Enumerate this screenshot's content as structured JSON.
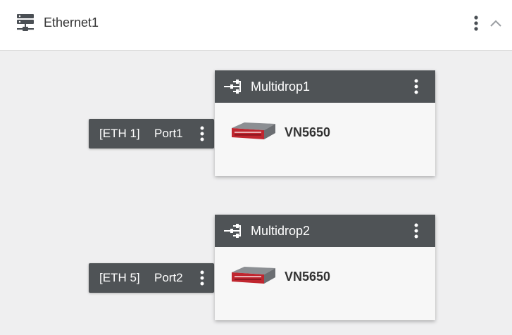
{
  "header": {
    "title": "Ethernet1",
    "network_icon": "server-network-icon",
    "menu_icon": "more-vertical-icon",
    "collapse_icon": "chevron-up-icon"
  },
  "ports": [
    {
      "tag": "[ETH 1]",
      "name": "Port1"
    },
    {
      "tag": "[ETH 5]",
      "name": "Port2"
    }
  ],
  "multidrops": [
    {
      "title": "Multidrop1",
      "device": "VN5650"
    },
    {
      "title": "Multidrop2",
      "device": "VN5650"
    }
  ],
  "colors": {
    "node_header": "#4f5356",
    "background": "#efeff0",
    "device_accent": "#c0262f"
  }
}
